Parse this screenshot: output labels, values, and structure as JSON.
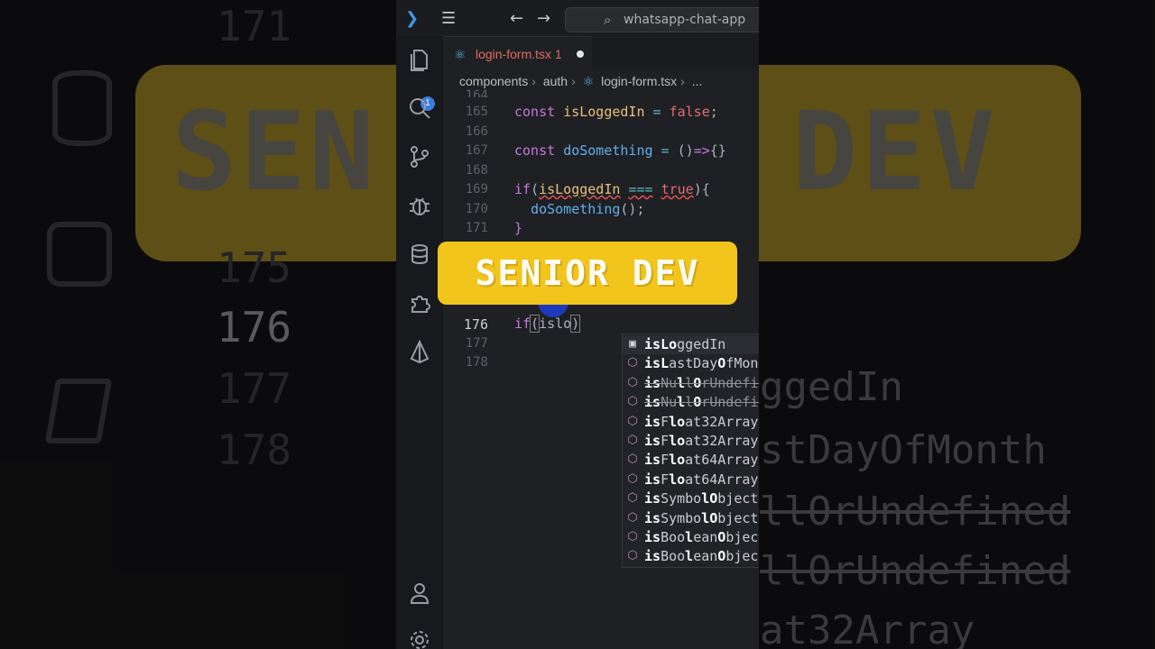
{
  "background": {
    "big_text_left": "SEN",
    "big_text_right": "DEV",
    "line_numbers": [
      "171",
      "175",
      "176",
      "177",
      "178"
    ],
    "suggestions": [
      "ggedIn",
      "stDayOfMonth",
      "llOrUndefined",
      "llOrUndefined",
      "at32Array"
    ]
  },
  "titlebar": {
    "search_text": "whatsapp-chat-app"
  },
  "activity_bar": {
    "explorer_badge": "1"
  },
  "tab": {
    "filename": "login-form.tsx 1"
  },
  "breadcrumb": {
    "items": [
      "components",
      "auth",
      "login-form.tsx",
      "..."
    ]
  },
  "editor": {
    "lines": [
      {
        "num": "164",
        "text": ""
      },
      {
        "num": "165",
        "text": "const isLoggedIn = false;"
      },
      {
        "num": "166",
        "text": ""
      },
      {
        "num": "167",
        "text": "const doSomething = ()=>{}"
      },
      {
        "num": "168",
        "text": ""
      },
      {
        "num": "169",
        "text": "if(isLoggedIn === true){"
      },
      {
        "num": "170",
        "text": "  doSomething();"
      },
      {
        "num": "171",
        "text": "}"
      },
      {
        "num": "176",
        "text": "if(islo)"
      },
      {
        "num": "177",
        "text": ""
      },
      {
        "num": "178",
        "text": ""
      }
    ]
  },
  "suggest_widget": {
    "items": [
      {
        "label": "isLoggedIn",
        "kind": "variable",
        "strike": false
      },
      {
        "label": "isLastDayOfMonth",
        "kind": "module",
        "strike": false
      },
      {
        "label": "isNullOrUndefined",
        "kind": "module",
        "strike": true
      },
      {
        "label": "isNullOrUndefined",
        "kind": "module",
        "strike": true
      },
      {
        "label": "isFloat32Array",
        "kind": "module",
        "strike": false
      },
      {
        "label": "isFloat32Array",
        "kind": "module",
        "strike": false
      },
      {
        "label": "isFloat64Array",
        "kind": "module",
        "strike": false
      },
      {
        "label": "isFloat64Array",
        "kind": "module",
        "strike": false
      },
      {
        "label": "isSymbolObject",
        "kind": "module",
        "strike": false
      },
      {
        "label": "isSymbolObject",
        "kind": "module",
        "strike": false
      },
      {
        "label": "isBooleanObject",
        "kind": "module",
        "strike": false
      },
      {
        "label": "isBooleanObject",
        "kind": "module",
        "strike": false
      }
    ]
  },
  "overlay": {
    "caption": "SENIOR DEV"
  },
  "colors": {
    "caption_bg": "#f2c51c",
    "accent": "#3b7ddd",
    "tab_modified": "#e06c60"
  }
}
